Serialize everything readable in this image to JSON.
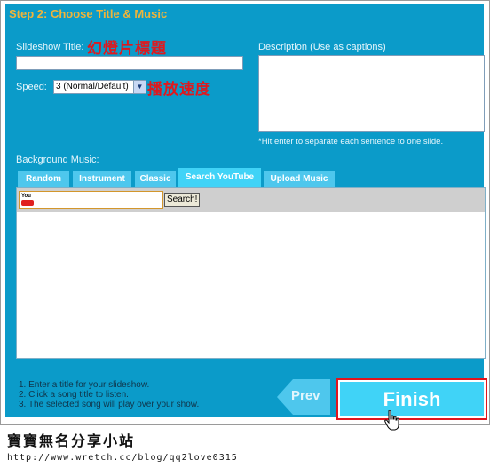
{
  "step_title": "Step 2: Choose Title & Music",
  "fields": {
    "slideshow_title_label": "Slideshow Title:",
    "slideshow_title_annotation": "幻燈片標題",
    "slideshow_title_value": "",
    "speed_label": "Speed:",
    "speed_value": "3 (Normal/Default)",
    "speed_annotation": "播放速度",
    "description_label": "Description (Use as captions)",
    "description_value": "",
    "description_hint": "*Hit enter to separate each sentence to one slide."
  },
  "background_music": {
    "label": "Background Music:",
    "tabs": [
      {
        "label": "Random"
      },
      {
        "label": "Instrument"
      },
      {
        "label": "Classic"
      },
      {
        "label": "Search YouTube"
      },
      {
        "label": "Upload Music"
      }
    ],
    "active_tab": "Search YouTube",
    "search_value": "",
    "search_button": "Search!",
    "youtube_logo": "YouTube"
  },
  "instructions": [
    "1. Enter a title for your slideshow.",
    "2. Click a song title to listen.",
    "3. The selected song will play over your show."
  ],
  "buttons": {
    "prev": "Prev",
    "finish": "Finish"
  },
  "footer": {
    "site_name": "寶寶無名分享小站",
    "url": "http://www.wretch.cc/blog/qq2love0315"
  },
  "colors": {
    "panel": "#0b9bc9",
    "tab": "#4ec7ed",
    "accent_title": "#f0b43a",
    "annotation_red": "#e0181d"
  },
  "icons": {
    "cursor": "hand-pointer-icon",
    "select_arrow": "chevron-down-icon"
  }
}
